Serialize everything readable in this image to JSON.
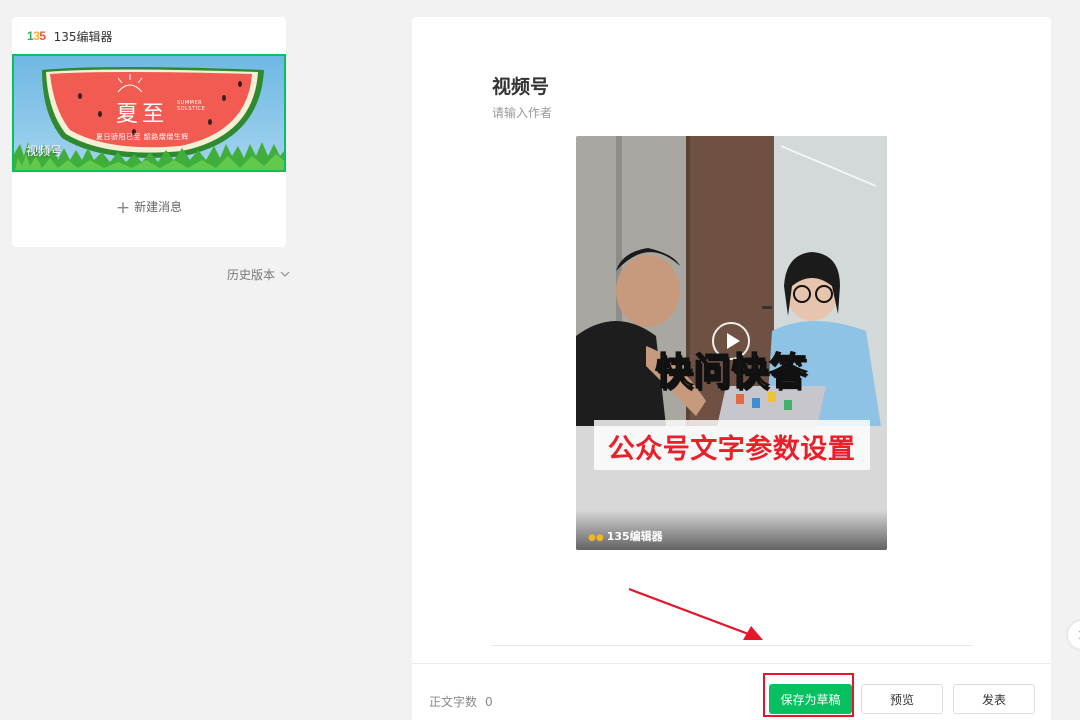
{
  "sidebar": {
    "brand_logo": "135",
    "brand_name": "135编辑器",
    "cover": {
      "title": "视频号",
      "headline": "夏至",
      "tagline": "夏日骄阳已至 韶路熠熠生辉",
      "english": "SUMMER SOLSTICE"
    },
    "new_message_label": "新建消息",
    "history_label": "历史版本"
  },
  "editor": {
    "title": "视频号",
    "author_placeholder": "请输入作者",
    "video": {
      "headline": "快问快答",
      "subtitle": "公众号文字参数设置",
      "brand": "135编辑器"
    }
  },
  "footer": {
    "word_count_label": "正文字数",
    "word_count": "0",
    "save_draft_label": "保存为草稿",
    "preview_label": "预览",
    "publish_label": "发表"
  },
  "colors": {
    "accent": "#07c160",
    "highlight": "#e3162b"
  }
}
